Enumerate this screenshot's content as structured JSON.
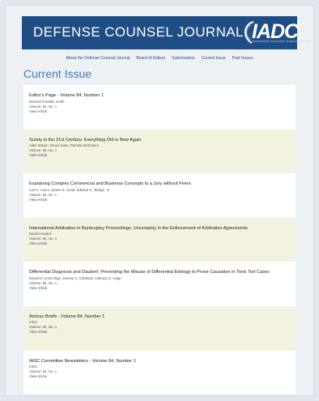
{
  "header": {
    "title": "DEFENSE COUNSEL JOURNAL",
    "logo_text": "IADC",
    "logo_tagline": "INTERNATIONAL ASSOCIATION OF DEFENSE COUNSEL"
  },
  "nav": {
    "items": [
      {
        "label": "About the Defense Counsel Journal"
      },
      {
        "label": "Board of Editors"
      },
      {
        "label": "Submissions"
      },
      {
        "label": "Current Issue"
      },
      {
        "label": "Past Issues"
      }
    ]
  },
  "page_title": "Current Issue",
  "articles": [
    {
      "title": "Editor's Page - Volume 84, Number 1",
      "authors": "Michael Franklin Smith",
      "volume": "Volume: 84, No. 1",
      "link": "View Article"
    },
    {
      "title": "Surety in the 21st Century: Everything Old is New Again",
      "authors": "Allen Bitsoin, Bruce Kahn, Pamela McDovern",
      "volume": "Volume: 84, No. 1",
      "link": "View Article"
    },
    {
      "title": "Explaining Complex Commercial and Business Concepts to a Jury without Peers",
      "authors": "Carl A. Aveni, James E. Hood, Edward S. Sledge, IV",
      "volume": "Volume: 84, No. 1",
      "link": "View Article"
    },
    {
      "title": "International Arbitration in Bankruptcy Proceedings: Uncertainty in the Enforcement of Arbitration Agreements",
      "authors": "David Howard",
      "volume": "Volume: 84, No. 1",
      "link": "View Article"
    },
    {
      "title": "Differential Diagnosis and Daubert: Preventing the Misuse of Differential Etiology to Prove Causation in Toxic Tort Cases",
      "authors": "David M. Cummings, Jeremy S. Goldkind, Anthony G. Hopp",
      "volume": "Volume: 84, No. 1",
      "link": "View Article"
    },
    {
      "title": "Amicus Briefs - Volume 84, Number 1",
      "authors": "IADC",
      "volume": "Volume: 84, No. 1",
      "link": "View Article"
    },
    {
      "title": "IADC Committee Newsletters - Volume 84, Number 1",
      "authors": "IADC",
      "volume": "Volume: 84, No. 1",
      "link": "View Article"
    }
  ]
}
